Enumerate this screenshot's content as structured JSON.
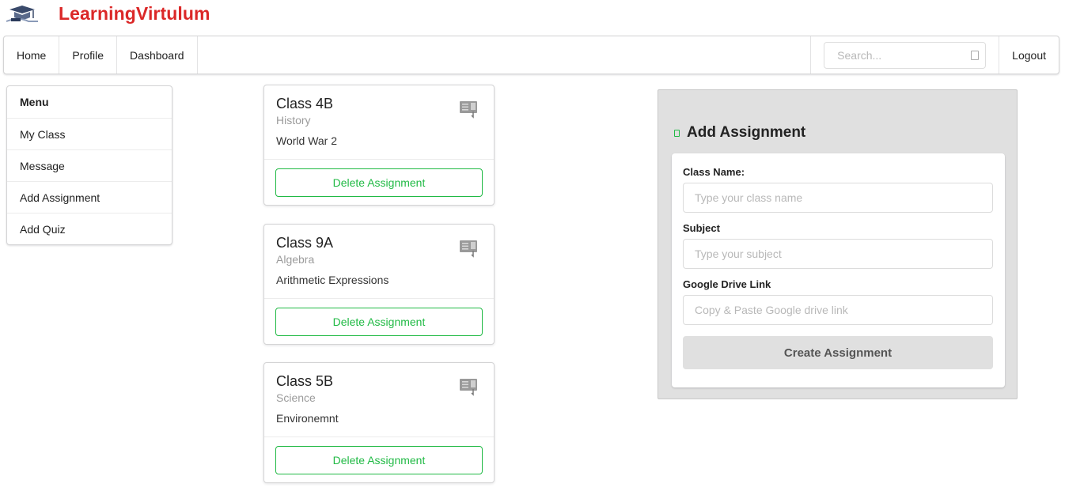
{
  "brand": {
    "name": "LearningVirtulum",
    "color": "#db2828",
    "logo_icon": "graduation-cap-logo"
  },
  "topmenu": {
    "items": [
      {
        "label": "Home"
      },
      {
        "label": "Profile"
      },
      {
        "label": "Dashboard"
      }
    ],
    "search_placeholder": "Search...",
    "search_icon": "search-icon",
    "logout_label": "Logout"
  },
  "sidemenu": {
    "header": "Menu",
    "items": [
      {
        "label": "My Class"
      },
      {
        "label": "Message"
      },
      {
        "label": "Add Assignment"
      },
      {
        "label": "Add Quiz"
      }
    ]
  },
  "cards": [
    {
      "title": "Class 4B",
      "subject": "History",
      "description": "World War 2",
      "button": "Delete Assignment",
      "icon": "assignment-icon"
    },
    {
      "title": "Class 9A",
      "subject": "Algebra",
      "description": "Arithmetic Expressions",
      "button": "Delete Assignment",
      "icon": "assignment-icon"
    },
    {
      "title": "Class 5B",
      "subject": "Science",
      "description": "Environemnt",
      "button": "Delete Assignment",
      "icon": "assignment-icon"
    }
  ],
  "form": {
    "header": "Add Assignment",
    "fields": [
      {
        "label": "Class Name:",
        "placeholder": "Type your class name",
        "value": ""
      },
      {
        "label": "Subject",
        "placeholder": "Type your subject",
        "value": ""
      },
      {
        "label": "Google Drive Link",
        "placeholder": "Copy & Paste Google drive link",
        "value": ""
      }
    ],
    "submit_label": "Create Assignment"
  },
  "colors": {
    "accent_green": "#21ba45",
    "brand_red": "#db2828",
    "panel_gray": "#e0e0e0"
  }
}
